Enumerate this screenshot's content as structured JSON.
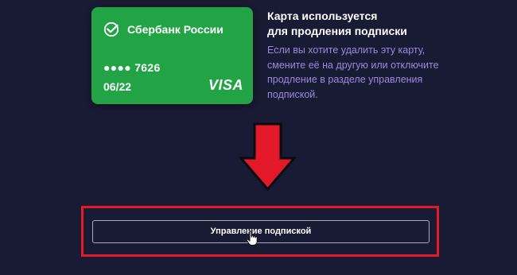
{
  "card": {
    "bank_name": "Сбербанк России",
    "number_masked": "●●●● 7626",
    "expiry": "06/22",
    "brand": "VISA",
    "color": "#22a346",
    "logo_icon": "sberbank-logo-icon"
  },
  "info": {
    "title_line1": "Карта используется",
    "title_line2": "для продления подписки",
    "text": "Если вы хотите удалить эту карту, смените её на другую или отключите продление в разделе управления подпиской."
  },
  "annotation": {
    "arrow_icon": "red-down-arrow-icon",
    "highlight_color": "#e3192a"
  },
  "button": {
    "label": "Управление подпиской"
  },
  "colors": {
    "background": "#191a33",
    "info_text": "#9b8bdc"
  }
}
